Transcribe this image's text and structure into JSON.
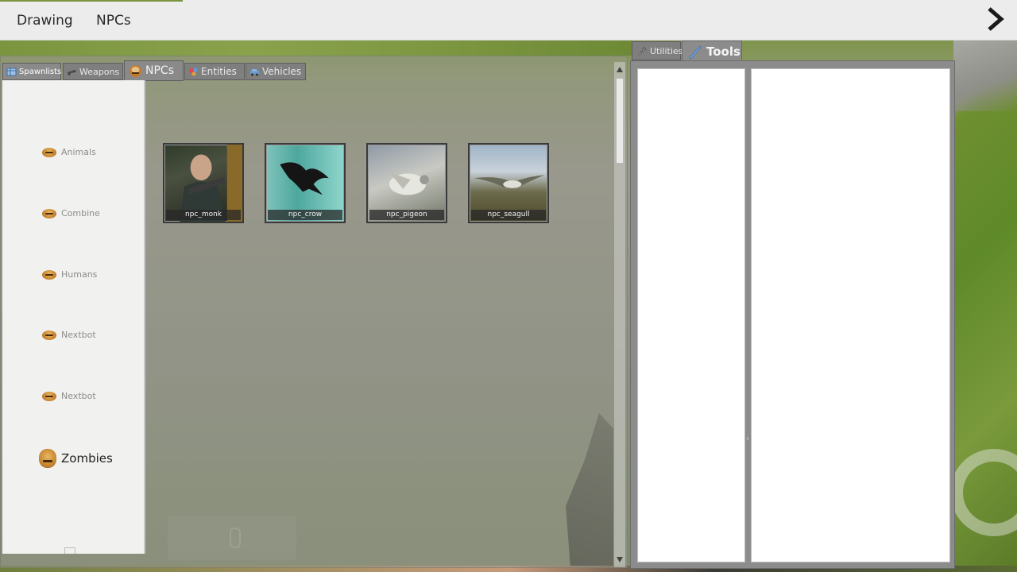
{
  "menubar": {
    "items": [
      "Drawing",
      "NPCs"
    ],
    "close_icon": "chevron-right-icon"
  },
  "spawnmenu": {
    "tabs": [
      {
        "label": "Spawnlists",
        "icon": "spawnlist-icon"
      },
      {
        "label": "Weapons",
        "icon": "weapon-icon"
      },
      {
        "label": "NPCs",
        "icon": "npc-face-icon"
      },
      {
        "label": "Entities",
        "icon": "entities-icon"
      },
      {
        "label": "Vehicles",
        "icon": "vehicle-icon"
      }
    ],
    "categories": [
      {
        "label": "Animals"
      },
      {
        "label": "Combine"
      },
      {
        "label": "Humans"
      },
      {
        "label": "Nextbot"
      },
      {
        "label": "Nextbot"
      },
      {
        "label": "Zombies"
      }
    ],
    "npcs": [
      {
        "label": "npc_monk"
      },
      {
        "label": "npc_crow"
      },
      {
        "label": "npc_pigeon"
      },
      {
        "label": "npc_seagull"
      }
    ]
  },
  "toolpanel": {
    "tabs": [
      {
        "label": "Utilities",
        "icon": "wrench-icon"
      },
      {
        "label": "Tools",
        "icon": "toolgun-icon"
      }
    ]
  },
  "colors": {
    "menubar_bg": "#ececec",
    "panel_gray": "#8c8c8c",
    "tab_gray": "#7f7f7f",
    "sidebar_bg": "#f1f1ef",
    "npc_face": "#c27d2b"
  }
}
